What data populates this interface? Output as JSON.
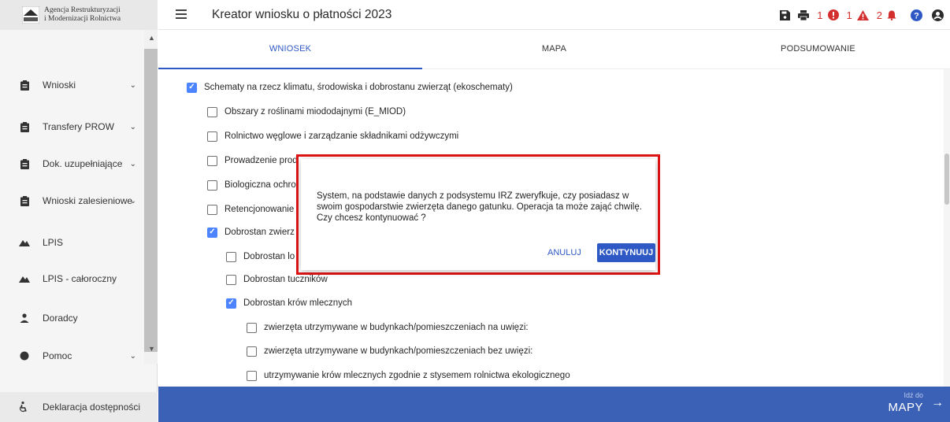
{
  "brand": {
    "line1": "Agencja Restrukturyzacji",
    "line2": "i Modernizacji Rolnictwa"
  },
  "sidebar": {
    "items": [
      {
        "label": "Wnioski",
        "icon": "clipboard-icon",
        "has_chevron": true
      },
      {
        "label": "Transfery PROW",
        "icon": "clipboard-icon",
        "has_chevron": true
      },
      {
        "label": "Dok. uzupełniające",
        "icon": "clipboard-icon",
        "has_chevron": true
      },
      {
        "label": "Wnioski zalesieniowe",
        "icon": "clipboard-icon",
        "has_chevron": true
      },
      {
        "label": "LPIS",
        "icon": "mountain-icon",
        "has_chevron": false
      },
      {
        "label": "LPIS - całoroczny",
        "icon": "mountain-icon",
        "has_chevron": false
      },
      {
        "label": "Doradcy",
        "icon": "person-icon",
        "has_chevron": false
      },
      {
        "label": "Pomoc",
        "icon": "help-icon",
        "has_chevron": true
      }
    ],
    "footer_label": "Deklaracja dostępności"
  },
  "header": {
    "title": "Kreator wniosku o płatności 2023",
    "badges": {
      "errors": "1",
      "warnings": "1",
      "notifications": "2"
    }
  },
  "tabs": [
    "WNIOSEK",
    "MAPA",
    "PODSUMOWANIE"
  ],
  "form": {
    "rows": [
      {
        "label": "Schematy na rzecz klimatu, środowiska i dobrostanu zwierząt (ekoschematy)",
        "checked": true
      },
      {
        "label": "Obszary z roślinami miododajnymi (E_MIOD)",
        "checked": false
      },
      {
        "label": "Rolnictwo węglowe i zarządzanie składnikami odżywczymi",
        "checked": false
      },
      {
        "label": "Prowadzenie prod",
        "checked": false
      },
      {
        "label": "Biologiczna ochro",
        "checked": false
      },
      {
        "label": "Retencjonowanie",
        "checked": false
      },
      {
        "label": "Dobrostan zwierz",
        "checked": true
      },
      {
        "label": "Dobrostan lo",
        "checked": false
      },
      {
        "label": "Dobrostan tuczników",
        "checked": false
      },
      {
        "label": "Dobrostan krów mlecznych",
        "checked": true
      },
      {
        "label": "zwierzęta utrzymywane w budynkach/pomieszczeniach na uwięzi:",
        "checked": false
      },
      {
        "label": "zwierzęta utrzymywane w budynkach/pomieszczeniach bez uwięzi:",
        "checked": false
      },
      {
        "label": "utrzymywanie krów mlecznych zgodnie z stysemem rolnictwa ekologicznego",
        "checked": false
      }
    ]
  },
  "dialog": {
    "message": "System, na podstawie danych z podsystemu IRZ zweryfkuje, czy posiadasz w swoim gospodarstwie zwierzęta danego gatunku. Operacja ta może zająć chwilę. Czy chcesz kontynuować ?",
    "cancel_label": "ANULUJ",
    "continue_label": "KONTYNUUJ"
  },
  "footer_nav": {
    "sub_label": "Idź do",
    "main_label": "MAPY"
  },
  "colors": {
    "accent": "#2e59c4",
    "bottom_bar": "#3b61b6",
    "checkbox": "#4c84ff",
    "error": "#d32f2f",
    "highlight_frame": "#e01414"
  }
}
